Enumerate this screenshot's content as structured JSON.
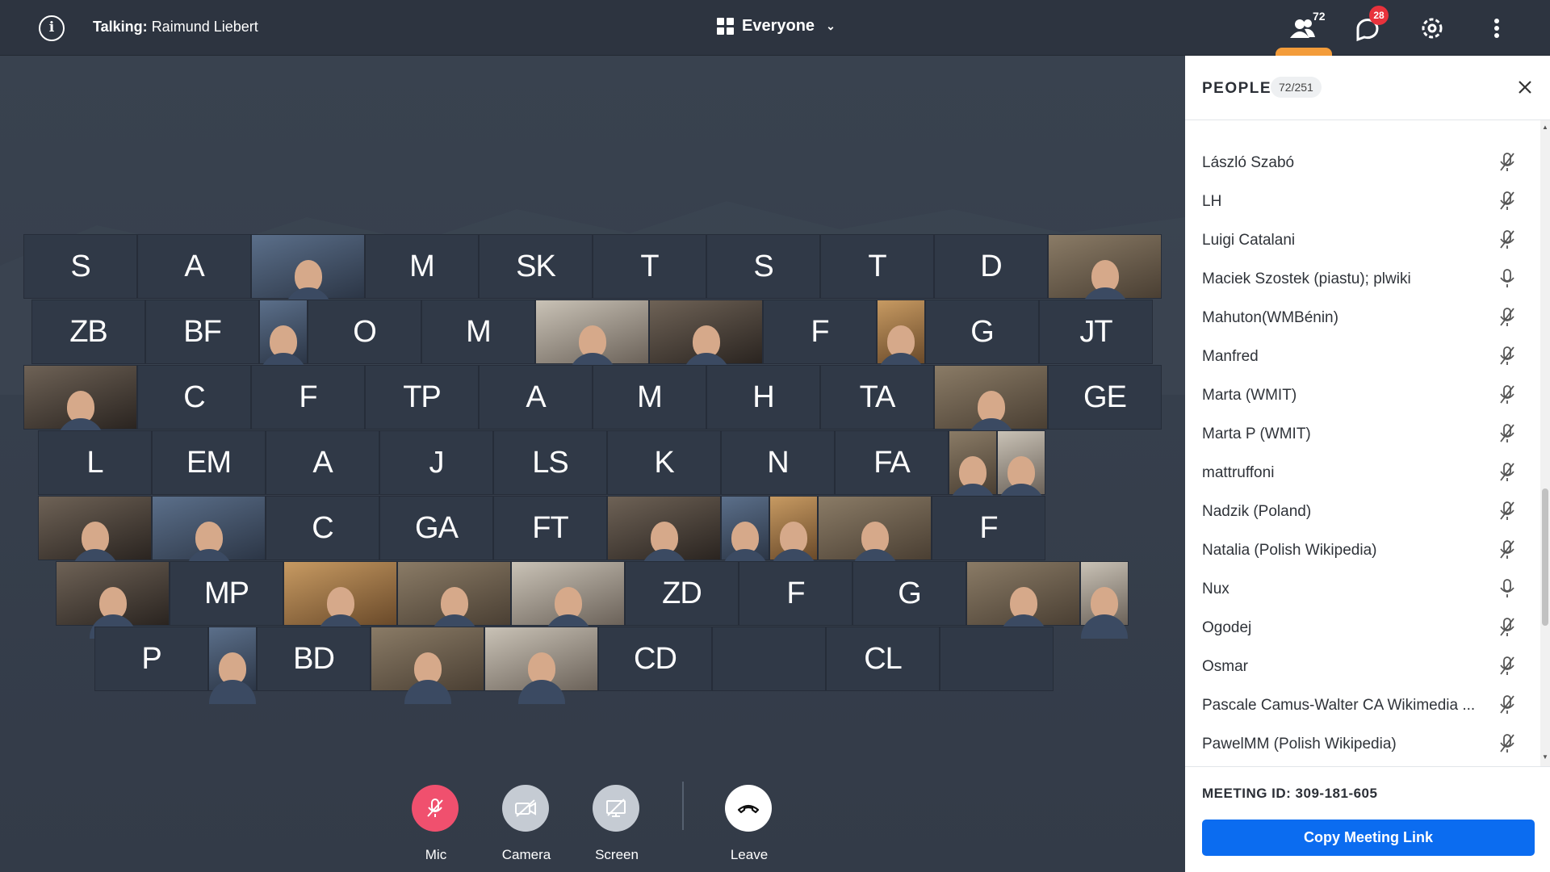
{
  "topbar": {
    "talking_label": "Talking:",
    "talking_name": "Raimund Liebert",
    "view_label": "Everyone",
    "people_count": "72",
    "chat_badge": "28"
  },
  "tiles": [
    {
      "row": 0,
      "label": "S"
    },
    {
      "row": 0,
      "label": "A"
    },
    {
      "row": 0,
      "label": "",
      "video": true
    },
    {
      "row": 0,
      "label": "M"
    },
    {
      "row": 0,
      "label": "SK"
    },
    {
      "row": 0,
      "label": "T"
    },
    {
      "row": 0,
      "label": "S"
    },
    {
      "row": 0,
      "label": "T"
    },
    {
      "row": 0,
      "label": "D"
    },
    {
      "row": 0,
      "label": "",
      "video": true
    },
    {
      "row": 1,
      "label": "ZB"
    },
    {
      "row": 1,
      "label": "BF"
    },
    {
      "row": 1,
      "label": "",
      "video": true,
      "narrow": true
    },
    {
      "row": 1,
      "label": "O"
    },
    {
      "row": 1,
      "label": "M"
    },
    {
      "row": 1,
      "label": "",
      "video": true
    },
    {
      "row": 1,
      "label": "",
      "video": true
    },
    {
      "row": 1,
      "label": "F"
    },
    {
      "row": 1,
      "label": "",
      "video": true,
      "narrow": true
    },
    {
      "row": 1,
      "label": "G"
    },
    {
      "row": 1,
      "label": "JT"
    },
    {
      "row": 2,
      "label": "",
      "video": true
    },
    {
      "row": 2,
      "label": "C"
    },
    {
      "row": 2,
      "label": "F"
    },
    {
      "row": 2,
      "label": "TP"
    },
    {
      "row": 2,
      "label": "A"
    },
    {
      "row": 2,
      "label": "M"
    },
    {
      "row": 2,
      "label": "H"
    },
    {
      "row": 2,
      "label": "TA"
    },
    {
      "row": 2,
      "label": "",
      "video": true
    },
    {
      "row": 2,
      "label": "GE"
    },
    {
      "row": 3,
      "label": "L"
    },
    {
      "row": 3,
      "label": "EM"
    },
    {
      "row": 3,
      "label": "A"
    },
    {
      "row": 3,
      "label": "J"
    },
    {
      "row": 3,
      "label": "LS"
    },
    {
      "row": 3,
      "label": "K"
    },
    {
      "row": 3,
      "label": "N"
    },
    {
      "row": 3,
      "label": "FA"
    },
    {
      "row": 3,
      "label": "",
      "video": true,
      "narrow": true
    },
    {
      "row": 3,
      "label": "",
      "video": true,
      "narrow": true
    },
    {
      "row": 4,
      "label": "",
      "video": true
    },
    {
      "row": 4,
      "label": "",
      "video": true
    },
    {
      "row": 4,
      "label": "C"
    },
    {
      "row": 4,
      "label": "GA"
    },
    {
      "row": 4,
      "label": "FT"
    },
    {
      "row": 4,
      "label": "",
      "video": true
    },
    {
      "row": 4,
      "label": "",
      "video": true,
      "narrow": true
    },
    {
      "row": 4,
      "label": "",
      "video": true,
      "narrow": true
    },
    {
      "row": 4,
      "label": "",
      "video": true
    },
    {
      "row": 4,
      "label": "F"
    },
    {
      "row": 5,
      "label": "",
      "video": true
    },
    {
      "row": 5,
      "label": "MP"
    },
    {
      "row": 5,
      "label": "",
      "video": true
    },
    {
      "row": 5,
      "label": "",
      "video": true
    },
    {
      "row": 5,
      "label": "",
      "video": true
    },
    {
      "row": 5,
      "label": "ZD"
    },
    {
      "row": 5,
      "label": "F"
    },
    {
      "row": 5,
      "label": "G"
    },
    {
      "row": 5,
      "label": "",
      "video": true
    },
    {
      "row": 5,
      "label": "",
      "video": true,
      "narrow": true
    },
    {
      "row": 6,
      "label": "P"
    },
    {
      "row": 6,
      "label": "",
      "video": true,
      "narrow": true
    },
    {
      "row": 6,
      "label": "BD"
    },
    {
      "row": 6,
      "label": "",
      "video": true
    },
    {
      "row": 6,
      "label": "",
      "video": true
    },
    {
      "row": 6,
      "label": "CD"
    },
    {
      "row": 6,
      "label": ""
    },
    {
      "row": 6,
      "label": "CL"
    },
    {
      "row": 6,
      "label": ""
    }
  ],
  "controls": {
    "mic": "Mic",
    "camera": "Camera",
    "screen": "Screen",
    "leave": "Leave"
  },
  "sidebar": {
    "title": "PEOPLE",
    "count": "72/251",
    "people": [
      {
        "name": "László Szabó",
        "muted": true
      },
      {
        "name": "LH",
        "muted": true
      },
      {
        "name": "Luigi Catalani",
        "muted": true
      },
      {
        "name": "Maciek Szostek (piastu); plwiki",
        "muted": false
      },
      {
        "name": "Mahuton(WMBénin)",
        "muted": true
      },
      {
        "name": "Manfred",
        "muted": true
      },
      {
        "name": "Marta (WMIT)",
        "muted": true
      },
      {
        "name": "Marta P (WMIT)",
        "muted": true
      },
      {
        "name": "mattruffoni",
        "muted": true
      },
      {
        "name": "Nadzik (Poland)",
        "muted": true
      },
      {
        "name": "Natalia (Polish Wikipedia)",
        "muted": true
      },
      {
        "name": "Nux",
        "muted": false
      },
      {
        "name": "Ogodej",
        "muted": true
      },
      {
        "name": "Osmar",
        "muted": true
      },
      {
        "name": "Pascale Camus-Walter CA Wikimedia ...",
        "muted": true
      },
      {
        "name": "PawelMM (Polish Wikipedia)",
        "muted": true
      }
    ],
    "meeting_id_label": "MEETING ID: 309-181-605",
    "copy_link": "Copy Meeting Link"
  },
  "colors": {
    "accent": "#0b6cf0",
    "mic_muted": "#f0506e",
    "badge": "#e8323c",
    "active_tab": "#f39c3a"
  }
}
